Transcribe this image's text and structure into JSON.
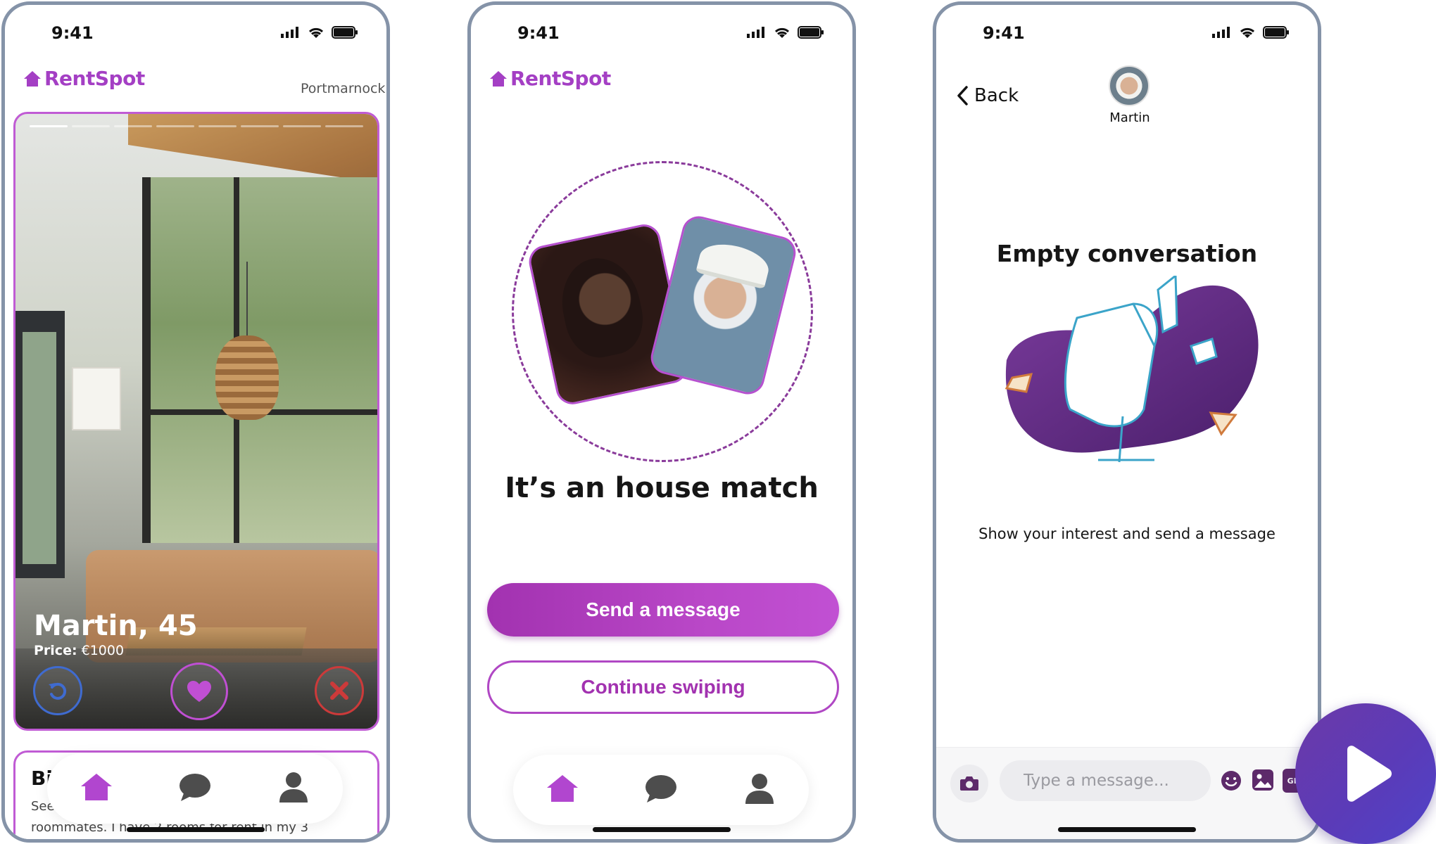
{
  "status": {
    "time": "9:41"
  },
  "brand": {
    "name": "RentSpot",
    "color": "#a43fc4"
  },
  "screen1": {
    "location": "Portmarnock",
    "listing": {
      "name": "Martin, 45",
      "price_label": "Price:",
      "price_value": "€1000",
      "progress_total": 8,
      "progress_active": 1
    },
    "bio": {
      "title": "Bi",
      "see": "See",
      "text": "roommates. I have 2 rooms for rent in my 3"
    },
    "icons": {
      "undo": "undo-icon",
      "like": "heart-icon",
      "nope": "close-icon"
    }
  },
  "screen2": {
    "title": "It’s an house match",
    "primary_button": "Send a message",
    "secondary_button": "Continue swiping"
  },
  "screen3": {
    "back_label": "Back",
    "contact_name": "Martin",
    "empty_title": "Empty conversation",
    "empty_subtitle": "Show your interest and send a message",
    "input_placeholder": "Type a message...",
    "gif_label": "GIF"
  },
  "tabbar": {
    "items": [
      "home-icon",
      "chat-icon",
      "profile-icon"
    ],
    "active_color": "#b146cf",
    "inactive_color": "#4d4d4d"
  },
  "colors": {
    "accent": "#b146cf",
    "undo": "#3f6bd0",
    "nope": "#cc3a3a",
    "fab_start": "#6c3aa8",
    "fab_end": "#4e43c8"
  }
}
